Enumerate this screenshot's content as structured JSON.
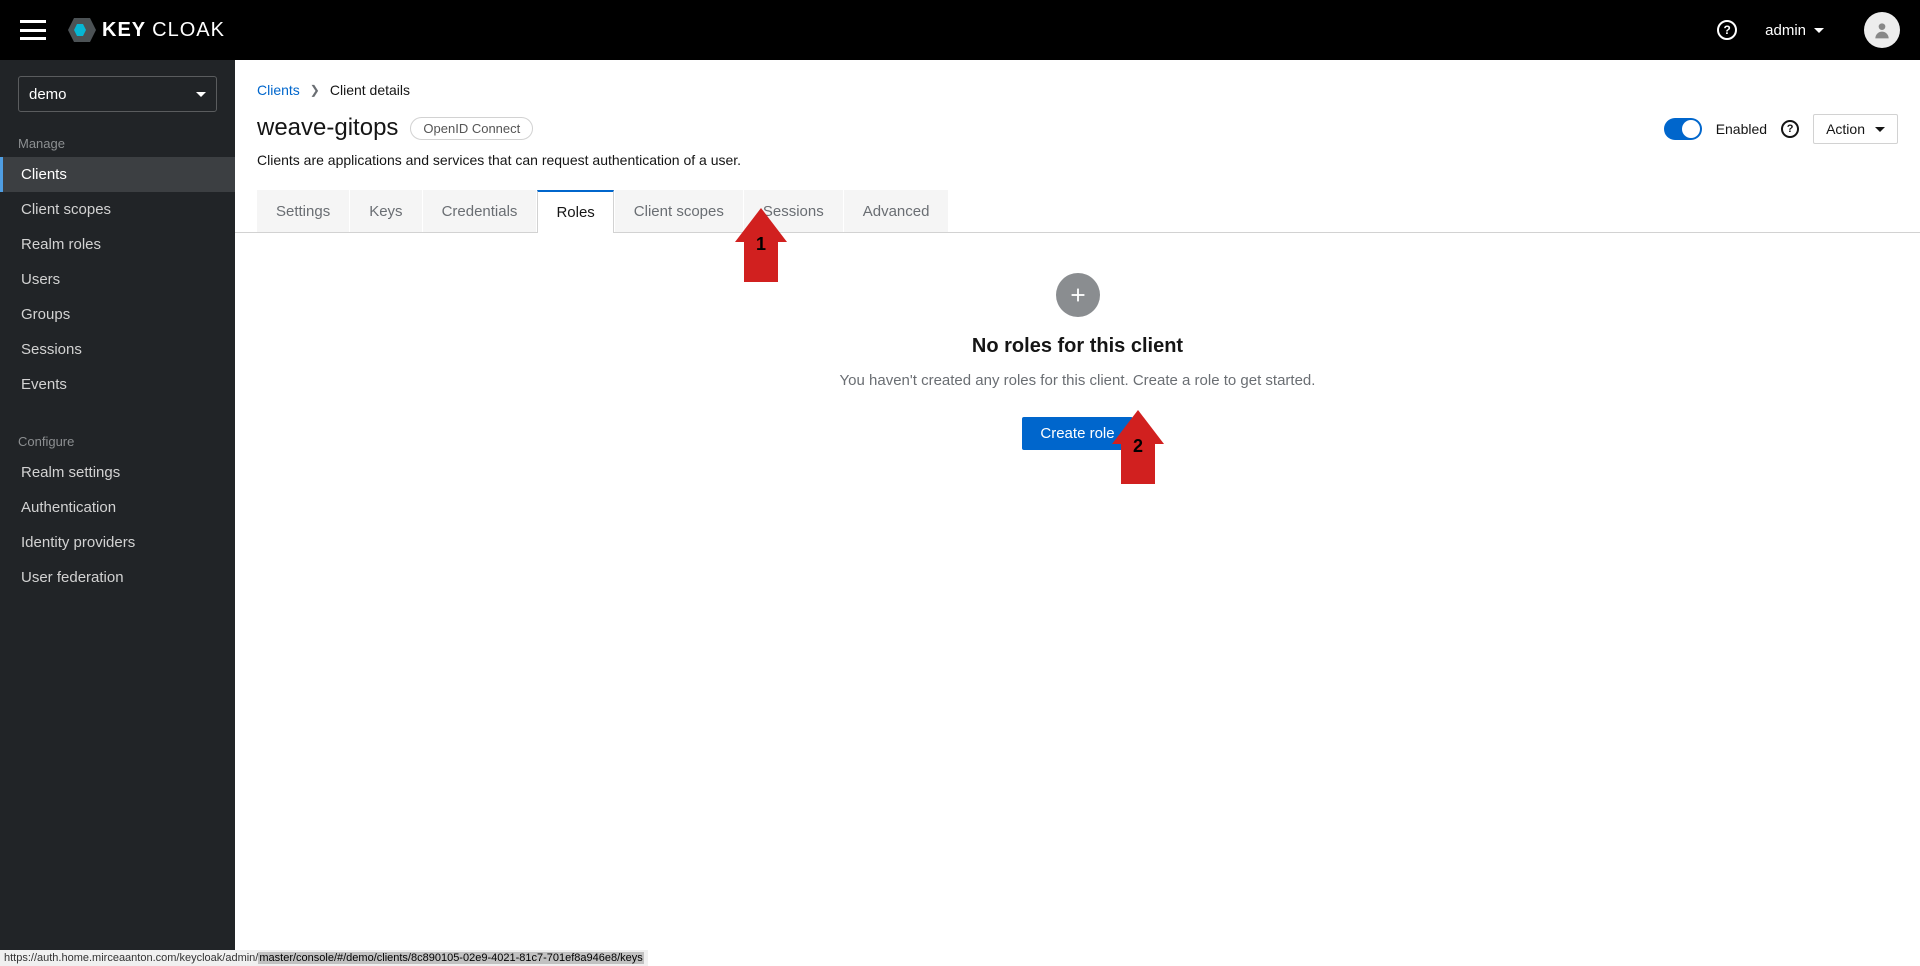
{
  "brand": {
    "strong": "KEY",
    "light": "CLOAK"
  },
  "header": {
    "help_glyph": "?",
    "user_label": "admin"
  },
  "sidebar": {
    "realm": "demo",
    "sections": [
      {
        "title": "Manage",
        "items": [
          {
            "label": "Clients",
            "active": true
          },
          {
            "label": "Client scopes"
          },
          {
            "label": "Realm roles"
          },
          {
            "label": "Users"
          },
          {
            "label": "Groups"
          },
          {
            "label": "Sessions"
          },
          {
            "label": "Events"
          }
        ]
      },
      {
        "title": "Configure",
        "items": [
          {
            "label": "Realm settings"
          },
          {
            "label": "Authentication"
          },
          {
            "label": "Identity providers"
          },
          {
            "label": "User federation"
          }
        ]
      }
    ]
  },
  "breadcrumb": {
    "link": "Clients",
    "current": "Client details"
  },
  "page": {
    "title": "weave-gitops",
    "protocol_chip": "OpenID Connect",
    "description": "Clients are applications and services that can request authentication of a user.",
    "enabled_label": "Enabled",
    "action_label": "Action",
    "help_glyph": "?"
  },
  "tabs": [
    "Settings",
    "Keys",
    "Credentials",
    "Roles",
    "Client scopes",
    "Sessions",
    "Advanced"
  ],
  "active_tab_index": 3,
  "empty": {
    "title": "No roles for this client",
    "text": "You haven't created any roles for this client. Create a role to get started.",
    "button": "Create role"
  },
  "annotations": {
    "a1": "1",
    "a2": "2"
  },
  "url": {
    "prefix": "https://auth.home.mirceaanton.com/keycloak/admin/",
    "highlight": "master/console/#/demo/clients/8c890105-02e9-4021-81c7-701ef8a946e8/keys"
  }
}
